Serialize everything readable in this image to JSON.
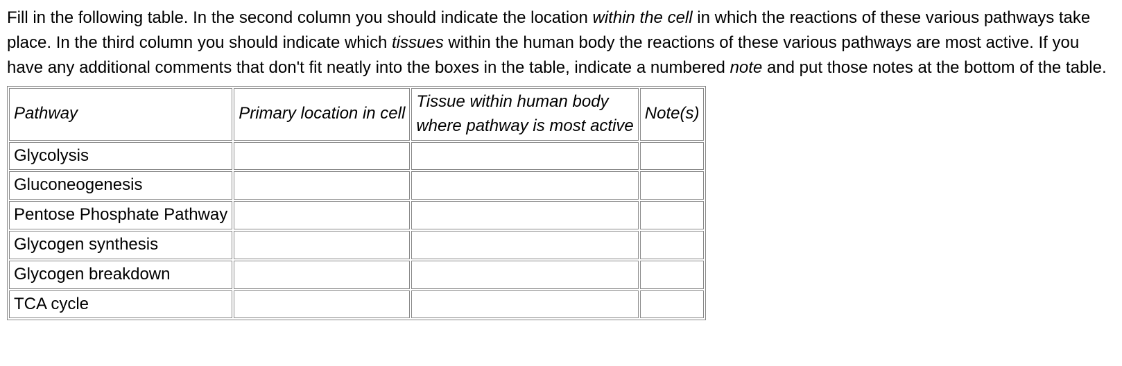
{
  "instructions": {
    "part1": "Fill in the following table. In the second column you should indicate the location ",
    "em1": "within the cell",
    "part2": " in which the reactions of these various pathways take place. In the third column you should indicate which ",
    "em2": "tissues",
    "part3": " within the human body the reactions of these various pathways are most active. If you have any additional comments that don't fit neatly into the boxes in the table, indicate a numbered ",
    "em3": "note",
    "part4": " and put those notes at the bottom of the table."
  },
  "table": {
    "headers": {
      "col1": "Pathway",
      "col2": "Primary location in cell",
      "col3_line1": "Tissue within human body",
      "col3_line2": "where pathway is most active",
      "col4": "Note(s)"
    },
    "rows": [
      {
        "pathway": "Glycolysis",
        "location": "",
        "tissue": "",
        "note": ""
      },
      {
        "pathway": "Gluconeogenesis",
        "location": "",
        "tissue": "",
        "note": ""
      },
      {
        "pathway": "Pentose Phosphate Pathway",
        "location": "",
        "tissue": "",
        "note": ""
      },
      {
        "pathway": "Glycogen synthesis",
        "location": "",
        "tissue": "",
        "note": ""
      },
      {
        "pathway": "Glycogen breakdown",
        "location": "",
        "tissue": "",
        "note": ""
      },
      {
        "pathway": "TCA cycle",
        "location": "",
        "tissue": "",
        "note": ""
      }
    ]
  }
}
